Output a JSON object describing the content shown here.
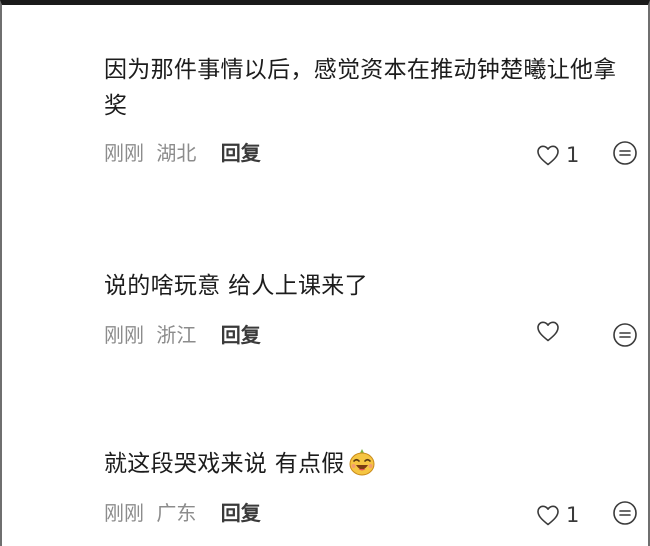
{
  "comments": [
    {
      "text": "因为那件事情以后，感觉资本在推动钟楚曦让他拿奖",
      "time": "刚刚",
      "location": "湖北",
      "reply_label": "回复",
      "likes": "1"
    },
    {
      "text": "说的啥玩意 给人上课来了",
      "time": "刚刚",
      "location": "浙江",
      "reply_label": "回复",
      "likes": ""
    },
    {
      "text": "就这段哭戏来说 有点假",
      "time": "刚刚",
      "location": "广东",
      "reply_label": "回复",
      "likes": "1"
    }
  ],
  "icons": {
    "like": "heart-outline-icon",
    "more": "more-options-icon",
    "emoji": "laughing-emoji-icon"
  }
}
